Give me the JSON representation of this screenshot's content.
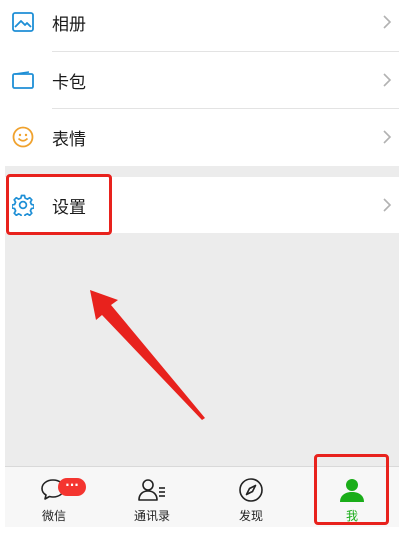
{
  "menu": {
    "items": [
      {
        "label": "相册",
        "icon": "photo-icon"
      },
      {
        "label": "卡包",
        "icon": "card-wallet-icon"
      },
      {
        "label": "表情",
        "icon": "smiley-icon"
      }
    ],
    "settings": {
      "label": "设置",
      "icon": "gear-icon"
    }
  },
  "tabbar": {
    "tabs": [
      {
        "label": "微信",
        "icon": "chat-bubble-icon",
        "badge": "···"
      },
      {
        "label": "通讯录",
        "icon": "contacts-icon"
      },
      {
        "label": "发现",
        "icon": "compass-icon"
      },
      {
        "label": "我",
        "icon": "person-icon",
        "active": true
      }
    ]
  },
  "colors": {
    "accent_green": "#1aad19",
    "icon_blue": "#1e8fd6",
    "icon_orange": "#f0a22e",
    "annotation_red": "#e8221d",
    "badge_red": "#f43530"
  }
}
